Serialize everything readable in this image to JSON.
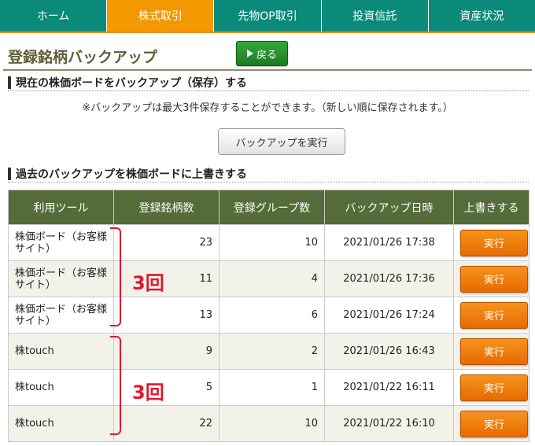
{
  "nav": {
    "tabs": [
      {
        "label": "ホーム"
      },
      {
        "label": "株式取引"
      },
      {
        "label": "先物OP取引"
      },
      {
        "label": "投資信託"
      },
      {
        "label": "資産状況"
      }
    ],
    "active_index": 1
  },
  "page": {
    "title": "登録銘柄バックアップ",
    "back_label": "戻る"
  },
  "section_backup": {
    "heading": "現在の株価ボードをバックアップ（保存）する",
    "note": "※バックアップは最大3件保存することができます。（新しい順に保存されます。）",
    "button_label": "バックアップを実行"
  },
  "section_restore": {
    "heading": "過去のバックアップを株価ボードに上書きする",
    "columns": [
      "利用ツール",
      "登録銘柄数",
      "登録グループ数",
      "バックアップ日時",
      "上書きする"
    ],
    "rows": [
      {
        "tool": "株価ボード（お客様サイト）",
        "stocks": "23",
        "groups": "10",
        "datetime": "2021/01/26 17:38",
        "action": "実行"
      },
      {
        "tool": "株価ボード（お客様サイト）",
        "stocks": "11",
        "groups": "4",
        "datetime": "2021/01/26 17:36",
        "action": "実行"
      },
      {
        "tool": "株価ボード（お客様サイト）",
        "stocks": "13",
        "groups": "6",
        "datetime": "2021/01/26 17:24",
        "action": "実行"
      },
      {
        "tool": "株touch",
        "stocks": "9",
        "groups": "2",
        "datetime": "2021/01/26 16:43",
        "action": "実行"
      },
      {
        "tool": "株touch",
        "stocks": "5",
        "groups": "1",
        "datetime": "2021/01/22 16:11",
        "action": "実行"
      },
      {
        "tool": "株touch",
        "stocks": "22",
        "groups": "10",
        "datetime": "2021/01/22 16:10",
        "action": "実行"
      }
    ]
  },
  "annotations": {
    "group1_label": "3回",
    "group2_label": "3回"
  },
  "colors": {
    "nav_bg": "#0b8a7a",
    "nav_active": "#f39800",
    "header_bg": "#556b3a",
    "exec_orange": "#e76a00",
    "annotation_red": "#e0182c"
  }
}
